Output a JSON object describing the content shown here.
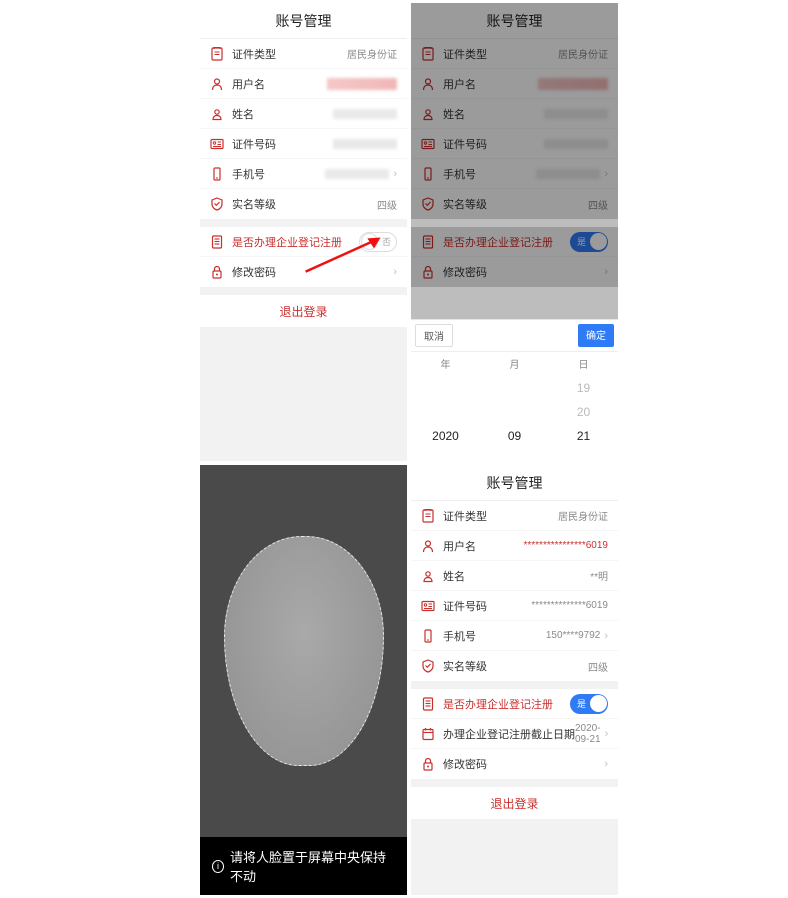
{
  "colors": {
    "accent": "#c8302e",
    "toggle_on": "#2f7af5"
  },
  "header_title": "账号管理",
  "icons": {
    "doctype": "doctype-icon",
    "user": "user-icon",
    "person": "person-icon",
    "idcard": "idcard-icon",
    "phone": "phone-icon",
    "shield": "shield-icon",
    "doc_red": "doc-red-icon",
    "lock": "lock-icon",
    "cal": "calendar-icon"
  },
  "labels": {
    "doctype": "证件类型",
    "username": "用户名",
    "realname": "姓名",
    "idnum": "证件号码",
    "phone": "手机号",
    "level": "实名等级",
    "register": "是否办理企业登记注册",
    "deadline": "办理企业登记注册截止日期",
    "chpwd": "修改密码",
    "logout": "退出登录"
  },
  "toggle_labels": {
    "on": "是",
    "off": "否"
  },
  "panel1": {
    "doctype_val": "居民身份证",
    "level_val": "四级",
    "toggle": "off"
  },
  "panel2": {
    "doctype_val": "居民身份证",
    "level_val": "四级",
    "toggle": "on",
    "picker": {
      "cancel": "取消",
      "ok": "确定",
      "cols": [
        "年",
        "月",
        "日"
      ],
      "year": "2020",
      "month": "09",
      "day_prev1": "19",
      "day_prev2": "20",
      "day_sel": "21"
    }
  },
  "panel3": {
    "hint": "请将人脸置于屏幕中央保持不动"
  },
  "panel4": {
    "doctype_val": "居民身份证",
    "username_val": "****************6019",
    "realname_val": "**明",
    "idnum_val": "**************6019",
    "phone_val": "150****9792",
    "level_val": "四级",
    "toggle": "on",
    "deadline_val": "2020-09-21"
  }
}
